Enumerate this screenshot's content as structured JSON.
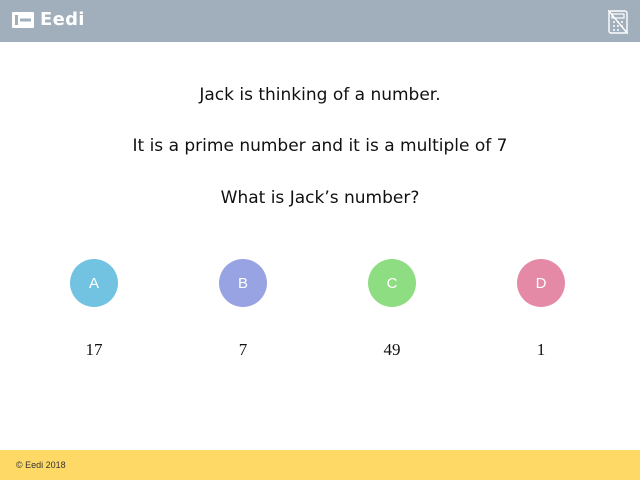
{
  "header": {
    "brand": "Eedi",
    "colors": {
      "header_bg": "#a1afbd",
      "footer_bg": "#ffd966"
    }
  },
  "question": {
    "line1": "Jack is thinking of a number.",
    "line2": "It is a prime number and it is a multiple of 7",
    "line3": "What is Jack’s number?"
  },
  "options": [
    {
      "letter": "A",
      "answer": "17",
      "color": "#72c3e2"
    },
    {
      "letter": "B",
      "answer": "7",
      "color": "#97a3e3"
    },
    {
      "letter": "C",
      "answer": "49",
      "color": "#8fdd82"
    },
    {
      "letter": "D",
      "answer": "1",
      "color": "#e48aa6"
    }
  ],
  "footer": {
    "copyright": "© Eedi 2018"
  },
  "icons": {
    "brand": "eedi-logo-icon",
    "calculator": "calculator-disabled-icon"
  }
}
